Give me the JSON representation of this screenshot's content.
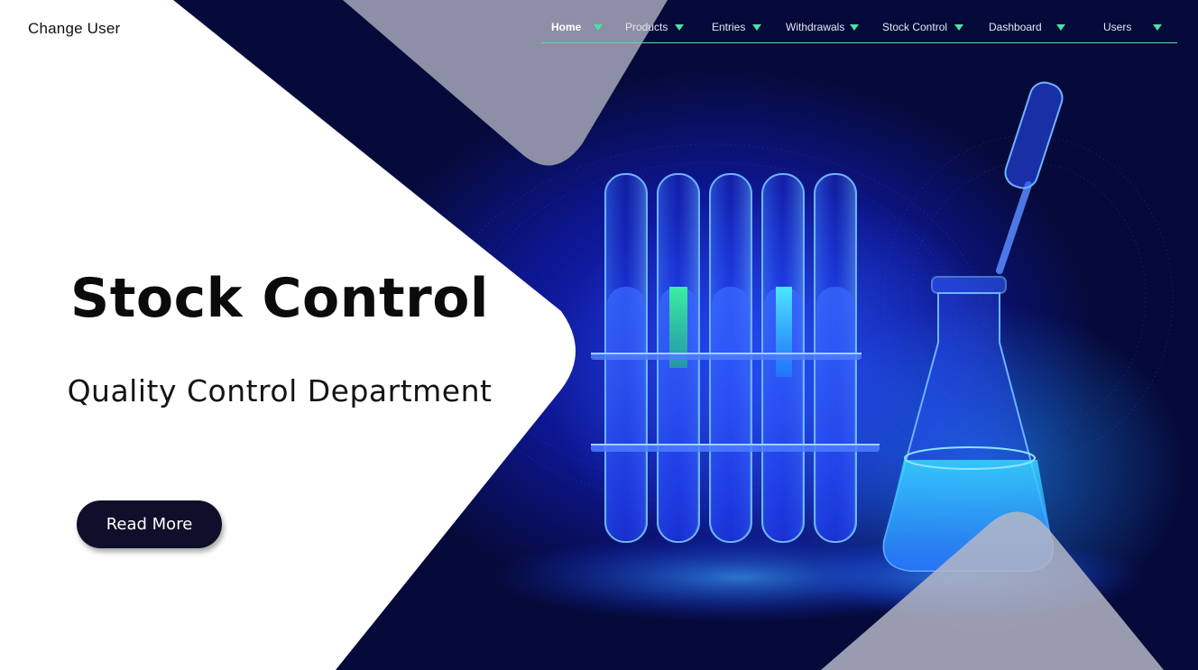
{
  "header": {
    "change_user": "Change User"
  },
  "nav": {
    "items": [
      {
        "label": "Home",
        "active": true
      },
      {
        "label": "Products"
      },
      {
        "label": "Entries"
      },
      {
        "label": "Withdrawals"
      },
      {
        "label": "Stock Control"
      },
      {
        "label": "Dashboard"
      },
      {
        "label": "Users"
      }
    ]
  },
  "hero": {
    "title": "Stock Control",
    "subtitle": "Quality Control Department",
    "button_label": "Read More"
  },
  "colors": {
    "accent": "#4fe0a4",
    "button_bg": "#0f0f2c",
    "hero_dark": "#060a3a",
    "hero_blue": "#1b2dd6"
  }
}
